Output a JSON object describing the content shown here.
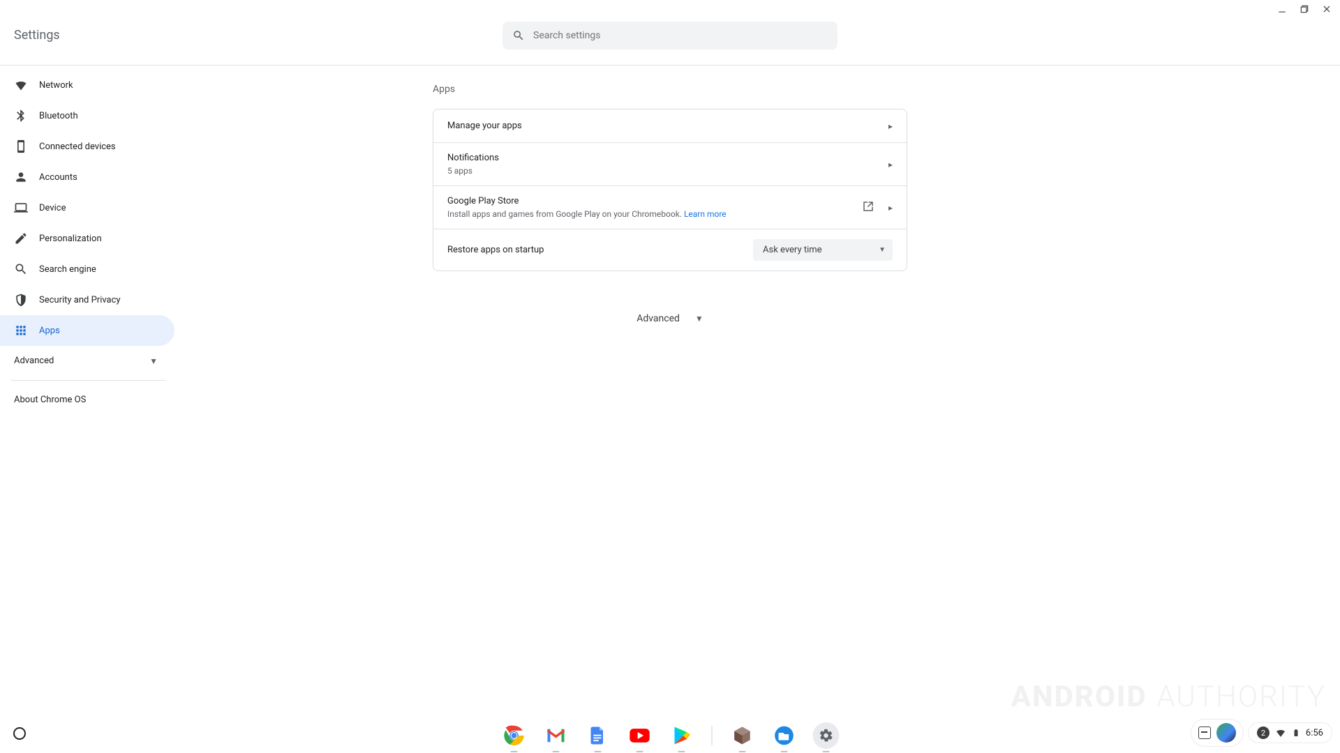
{
  "window": {
    "title": "Settings"
  },
  "search": {
    "placeholder": "Search settings"
  },
  "sidebar": {
    "items": [
      {
        "label": "Network"
      },
      {
        "label": "Bluetooth"
      },
      {
        "label": "Connected devices"
      },
      {
        "label": "Accounts"
      },
      {
        "label": "Device"
      },
      {
        "label": "Personalization"
      },
      {
        "label": "Search engine"
      },
      {
        "label": "Security and Privacy"
      },
      {
        "label": "Apps"
      }
    ],
    "advanced_label": "Advanced",
    "about_label": "About Chrome OS"
  },
  "main": {
    "section_title": "Apps",
    "rows": {
      "manage": {
        "title": "Manage your apps"
      },
      "notifications": {
        "title": "Notifications",
        "sub": "5 apps"
      },
      "play": {
        "title": "Google Play Store",
        "sub": "Install apps and games from Google Play on your Chromebook. ",
        "learn_more": "Learn more"
      },
      "restore": {
        "title": "Restore apps on startup",
        "selected": "Ask every time"
      }
    },
    "advanced_toggle": "Advanced"
  },
  "shelf": {
    "apps": [
      "chrome",
      "gmail",
      "docs",
      "youtube",
      "play",
      "package",
      "files",
      "settings"
    ]
  },
  "tray": {
    "notification_count": "2",
    "time": "6:56"
  },
  "watermark": {
    "a": "ANDROID",
    "b": "AUTHORITY"
  }
}
